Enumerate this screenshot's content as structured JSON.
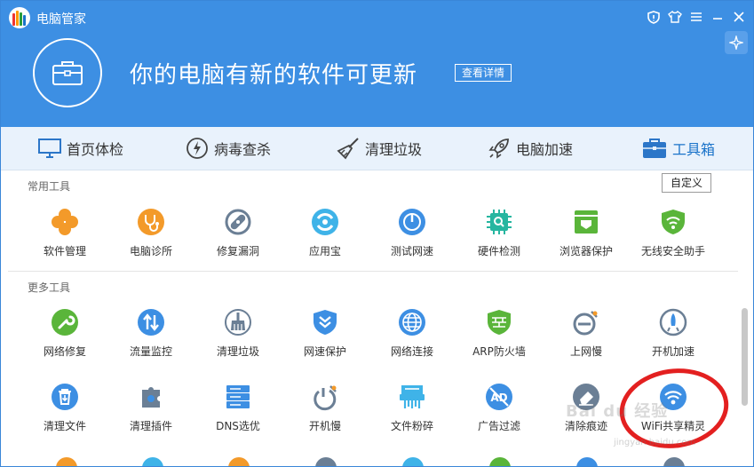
{
  "app": {
    "title": "电脑管家"
  },
  "header": {
    "headline": "你的电脑有新的软件可更新",
    "detail_button": "查看详情"
  },
  "nav": [
    {
      "label": "首页体检",
      "icon": "monitor-icon"
    },
    {
      "label": "病毒查杀",
      "icon": "lightning-icon"
    },
    {
      "label": "清理垃圾",
      "icon": "broom-icon"
    },
    {
      "label": "电脑加速",
      "icon": "rocket-icon"
    },
    {
      "label": "工具箱",
      "icon": "toolbox-icon",
      "active": true
    }
  ],
  "sections": {
    "common": {
      "label": "常用工具",
      "customize": "自定义"
    },
    "more": {
      "label": "更多工具"
    }
  },
  "common_tools": [
    {
      "label": "软件管理",
      "icon": "clover-icon",
      "color": "#f39a2a"
    },
    {
      "label": "电脑诊所",
      "icon": "stethoscope-icon",
      "color": "#f39a2a"
    },
    {
      "label": "修复漏洞",
      "icon": "bandaid-icon",
      "color": "#6b7f95"
    },
    {
      "label": "应用宝",
      "icon": "appstore-icon",
      "color": "#3fb3e8"
    },
    {
      "label": "测试网速",
      "icon": "speedometer-icon",
      "color": "#3d8fe3"
    },
    {
      "label": "硬件检测",
      "icon": "chip-icon",
      "color": "#26b6a0"
    },
    {
      "label": "浏览器保护",
      "icon": "browser-shield-icon",
      "color": "#5ab53a"
    },
    {
      "label": "无线安全助手",
      "icon": "wifi-shield-icon",
      "color": "#5ab53a"
    }
  ],
  "more_tools_row1": [
    {
      "label": "网络修复",
      "icon": "wrench-icon",
      "color": "#5ab53a"
    },
    {
      "label": "流量监控",
      "icon": "updown-arrows-icon",
      "color": "#3d8fe3"
    },
    {
      "label": "清理垃圾",
      "icon": "broom-icon",
      "color": "#6b7f95"
    },
    {
      "label": "网速保护",
      "icon": "shield-chevron-icon",
      "color": "#3d8fe3"
    },
    {
      "label": "网络连接",
      "icon": "globe-icon",
      "color": "#3d8fe3"
    },
    {
      "label": "ARP防火墙",
      "icon": "firewall-icon",
      "color": "#5ab53a"
    },
    {
      "label": "上网慢",
      "icon": "slow-browser-icon",
      "color": "#6b7f95"
    },
    {
      "label": "开机加速",
      "icon": "boost-icon",
      "color": "#6b7f95"
    }
  ],
  "more_tools_row2": [
    {
      "label": "清理文件",
      "icon": "trash-icon",
      "color": "#3d8fe3"
    },
    {
      "label": "清理插件",
      "icon": "puzzle-icon",
      "color": "#6b7f95"
    },
    {
      "label": "DNS选优",
      "icon": "server-icon",
      "color": "#3d8fe3"
    },
    {
      "label": "开机慢",
      "icon": "slow-power-icon",
      "color": "#6b7f95"
    },
    {
      "label": "文件粉碎",
      "icon": "shredder-icon",
      "color": "#3fb3e8"
    },
    {
      "label": "广告过滤",
      "icon": "ad-block-icon",
      "color": "#3d8fe3"
    },
    {
      "label": "清除痕迹",
      "icon": "eraser-icon",
      "color": "#6b7f95"
    },
    {
      "label": "WiFi共享精灵",
      "icon": "wifi-icon",
      "color": "#3d8fe3"
    }
  ],
  "watermark": {
    "text": "Bai du 经验",
    "sub": "jingyan.baidu.com"
  },
  "colors": {
    "brand": "#3d8fe3",
    "nav_bg": "#e9f2fc",
    "annotation": "#e32020"
  }
}
